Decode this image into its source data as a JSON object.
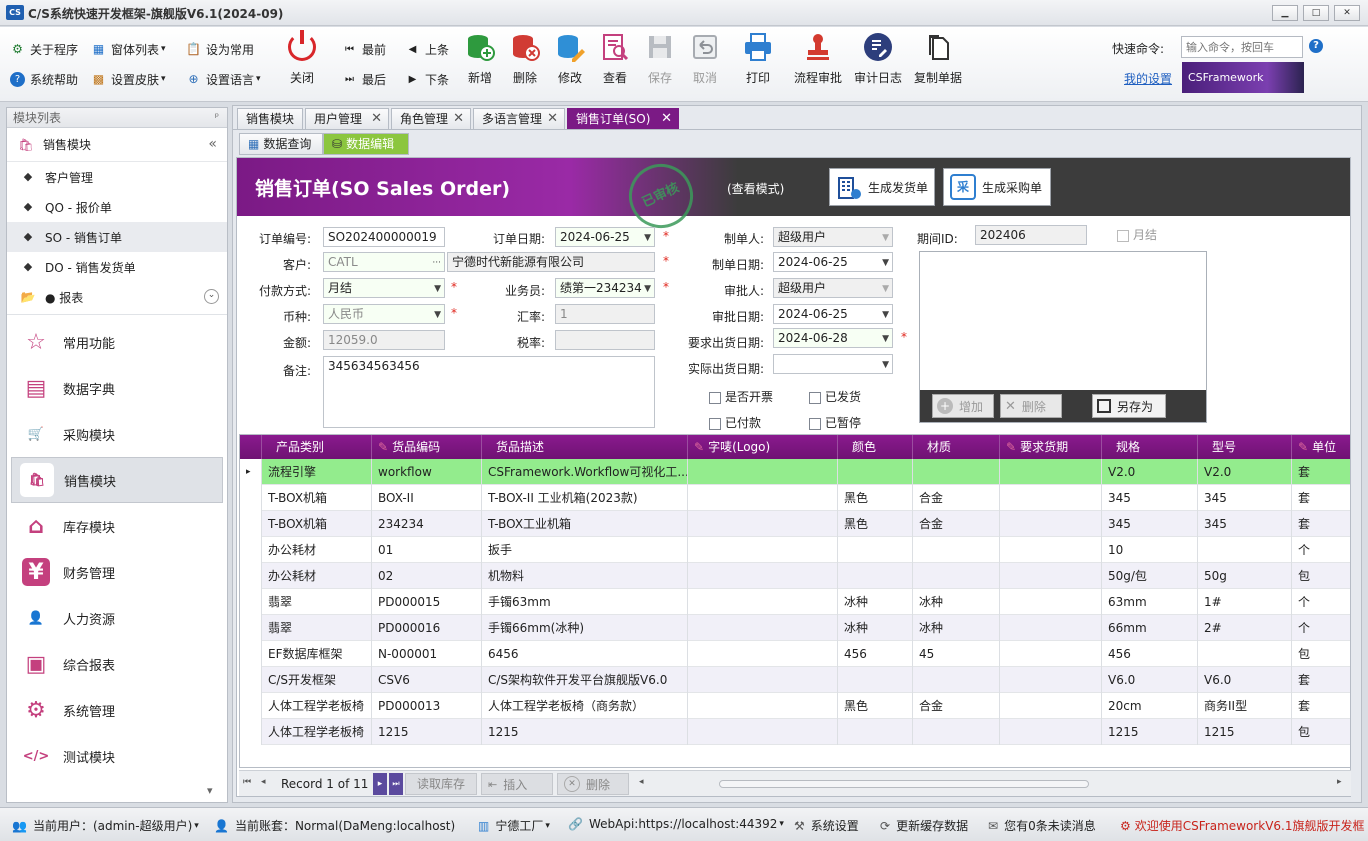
{
  "window": {
    "title": "C/S系统快速开发框架-旗舰版V6.1(2024-09)",
    "logo": "CS",
    "controls": [
      "▁",
      "□",
      "✕"
    ]
  },
  "toolbar": {
    "left_small": [
      {
        "label": "关于程序",
        "icon": "gear-icon"
      },
      {
        "label": "窗体列表",
        "icon": "windows-icon",
        "arrow": "▾"
      },
      {
        "label": "设为常用",
        "icon": "clipboard-icon"
      },
      {
        "label": "系统帮助",
        "icon": "help-icon"
      },
      {
        "label": "设置皮肤",
        "icon": "grid-icon",
        "arrow": "▾"
      },
      {
        "label": "设置语言",
        "icon": "globe-icon",
        "arrow": "▾"
      }
    ],
    "close": "关闭",
    "nav": [
      "最前",
      "上条",
      "最后",
      "下条"
    ],
    "big": [
      {
        "label": "新增",
        "icon": "add-db-icon",
        "enabled": true
      },
      {
        "label": "删除",
        "icon": "delete-db-icon",
        "enabled": true
      },
      {
        "label": "修改",
        "icon": "edit-db-icon",
        "enabled": true
      },
      {
        "label": "查看",
        "icon": "view-doc-icon",
        "enabled": true
      },
      {
        "label": "保存",
        "icon": "save-icon",
        "enabled": false
      },
      {
        "label": "取消",
        "icon": "undo-icon",
        "enabled": false
      },
      {
        "label": "打印",
        "icon": "printer-icon",
        "enabled": true
      },
      {
        "label": "流程审批",
        "icon": "stamp-icon",
        "enabled": true
      },
      {
        "label": "审计日志",
        "icon": "audit-log-icon",
        "enabled": true
      },
      {
        "label": "复制单据",
        "icon": "copy-doc-icon",
        "enabled": true
      }
    ],
    "quick_cmd_label": "快速命令:",
    "quick_cmd_placeholder": "输入命令，按回车",
    "my_settings": "我的设置",
    "brand": "CSFramework",
    "help_icon": "?"
  },
  "sidebar": {
    "header": "模块列表",
    "pin": "ᵖ",
    "current_module": "销售模块",
    "collapse": "«",
    "items": [
      {
        "label": "客户管理"
      },
      {
        "label": "QO - 报价单"
      },
      {
        "label": "SO - 销售订单",
        "selected": true
      },
      {
        "label": "DO - 销售发货单"
      },
      {
        "label": "● 报表",
        "folder": true
      }
    ],
    "expand": "⌄",
    "modules": [
      {
        "label": "常用功能",
        "icon": "star-icon"
      },
      {
        "label": "数据字典",
        "icon": "dictionary-icon"
      },
      {
        "label": "采购模块",
        "icon": "cart-icon"
      },
      {
        "label": "销售模块",
        "icon": "sales-bag-icon",
        "selected": true
      },
      {
        "label": "库存模块",
        "icon": "warehouse-icon"
      },
      {
        "label": "财务管理",
        "icon": "finance-icon"
      },
      {
        "label": "人力资源",
        "icon": "person-icon"
      },
      {
        "label": "综合报表",
        "icon": "report-icon"
      },
      {
        "label": "系统管理",
        "icon": "system-icon"
      },
      {
        "label": "测试模块",
        "icon": "code-icon"
      }
    ],
    "scroll_down": "▾"
  },
  "tabs": [
    {
      "label": "销售模块",
      "closable": false
    },
    {
      "label": "用户管理",
      "closable": true
    },
    {
      "label": "角色管理",
      "closable": true
    },
    {
      "label": "多语言管理",
      "closable": true
    },
    {
      "label": "销售订单(SO)",
      "closable": true,
      "active": true
    }
  ],
  "close_glyph": "✕",
  "subtabs": [
    {
      "label": "数据查询",
      "active": false
    },
    {
      "label": "数据编辑",
      "active": true
    }
  ],
  "banner": {
    "title": "销售订单(SO Sales Order)",
    "stamp": "已审核",
    "mode": "(查看模式)",
    "btn_delivery": "生成发货单",
    "btn_purchase": "生成采购单",
    "purchase_glyph": "采"
  },
  "form": {
    "order_no": {
      "label": "订单编号:",
      "value": "SO202400000019"
    },
    "order_date": {
      "label": "订单日期:",
      "value": "2024-06-25"
    },
    "customer": {
      "label": "客户:",
      "code": "CATL",
      "name": "宁德时代新能源有限公司",
      "ellipsis": "···"
    },
    "payment": {
      "label": "付款方式:",
      "value": "月结"
    },
    "salesman": {
      "label": "业务员:",
      "value": "绩第一234234"
    },
    "currency": {
      "label": "币种:",
      "value": "人民币"
    },
    "rate": {
      "label": "汇率:",
      "value": "1"
    },
    "amount": {
      "label": "金额:",
      "value": "12059.0"
    },
    "tax": {
      "label": "税率:",
      "value": ""
    },
    "remark": {
      "label": "备注:",
      "value": "345634563456"
    },
    "creator": {
      "label": "制单人:",
      "value": "超级用户"
    },
    "create_date": {
      "label": "制单日期:",
      "value": "2024-06-25"
    },
    "approver": {
      "label": "审批人:",
      "value": "超级用户"
    },
    "approve_date": {
      "label": "审批日期:",
      "value": "2024-06-25"
    },
    "req_ship": {
      "label": "要求出货日期:",
      "value": "2024-06-28"
    },
    "act_ship": {
      "label": "实际出货日期:",
      "value": ""
    },
    "period": {
      "label": "期间ID:",
      "value": "202406"
    },
    "month_end": "月结",
    "checks": [
      "是否开票",
      "已发货",
      "已付款",
      "已暂停"
    ],
    "attach": {
      "add": "增加",
      "delete": "删除",
      "save_as": "另存为"
    }
  },
  "grid": {
    "columns": [
      "产品类别",
      "货品编码",
      "货品描述",
      "字唛(Logo)",
      "颜色",
      "材质",
      "要求货期",
      "规格",
      "型号",
      "单位"
    ],
    "rows": [
      [
        "流程引擎",
        "workflow",
        "CSFramework.Workflow可视化工...",
        "",
        "",
        "",
        "",
        "V2.0",
        "V2.0",
        "套"
      ],
      [
        "T-BOX机箱",
        "BOX-II",
        "T-BOX-II 工业机箱(2023款)",
        "",
        "黑色",
        "合金",
        "",
        "345",
        "345",
        "套"
      ],
      [
        "T-BOX机箱",
        "234234",
        "T-BOX工业机箱",
        "",
        "黑色",
        "合金",
        "",
        "345",
        "345",
        "套"
      ],
      [
        "办公耗材",
        "01",
        "扳手",
        "",
        "",
        "",
        "",
        "10",
        "",
        "个"
      ],
      [
        "办公耗材",
        "02",
        "机物料",
        "",
        "",
        "",
        "",
        "50g/包",
        "50g",
        "包"
      ],
      [
        "翡翠",
        "PD000015",
        "手镯63mm",
        "",
        "冰种",
        "冰种",
        "",
        "63mm",
        "1#",
        "个"
      ],
      [
        "翡翠",
        "PD000016",
        "手镯66mm(冰种)",
        "",
        "冰种",
        "冰种",
        "",
        "66mm",
        "2#",
        "个"
      ],
      [
        "EF数据库框架",
        "N-000001",
        "6456",
        "",
        "456",
        "45",
        "",
        "456",
        "",
        "包"
      ],
      [
        "C/S开发框架",
        "CSV6",
        "C/S架构软件开发平台旗舰版V6.0",
        "",
        "",
        "",
        "",
        "V6.0",
        "V6.0",
        "套"
      ],
      [
        "人体工程学老板椅",
        "PD000013",
        "人体工程学老板椅（商务款）",
        "",
        "黑色",
        "合金",
        "",
        "20cm",
        "商务II型",
        "套"
      ],
      [
        "人体工程学老板椅",
        "1215",
        "1215",
        "",
        "",
        "",
        "",
        "1215",
        "1215",
        "包"
      ]
    ],
    "row_marker": "▸"
  },
  "navigator": {
    "record_text": "Record 1 of 11",
    "first": "⏮",
    "prev": "◂",
    "next": "▸",
    "last": "⏭",
    "read_stock": "读取库存",
    "insert": "插入",
    "delete": "删除",
    "scroll_left": "◂",
    "scroll_right": "▸"
  },
  "statusbar": {
    "user": "当前用户：(admin-超级用户)",
    "account": "当前账套：Normal(DaMeng:localhost)",
    "factory": "宁德工厂",
    "webapi": "WebApi:https://localhost:44392",
    "settings": "系统设置",
    "refresh": "更新缓存数据",
    "messages": "您有0条未读消息",
    "welcome": "欢迎使用CSFrameworkV6.1旗舰版开发框",
    "dropdown": "▾"
  },
  "colors": {
    "accent": "#7b1a85",
    "grid_header": "#7a157e",
    "selected_row": "#93ec8d",
    "alt_row": "#f1f0f8"
  }
}
